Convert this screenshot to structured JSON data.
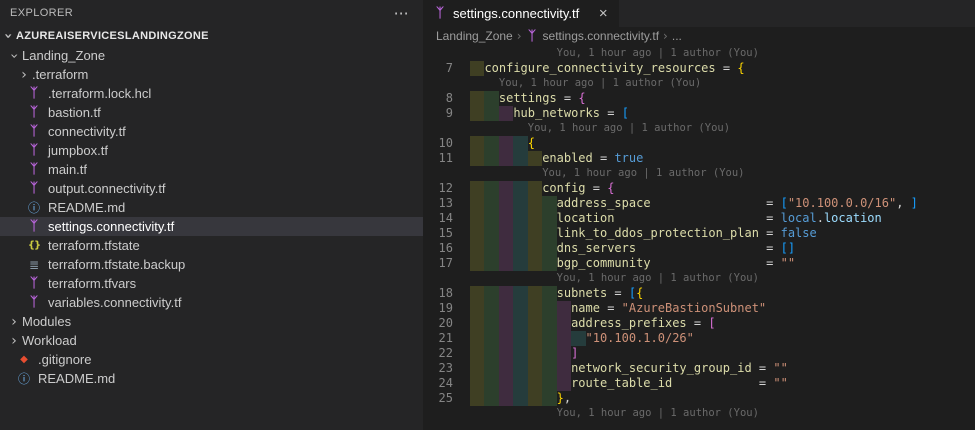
{
  "colors": {
    "accent": "#b764d8",
    "property": "#dcdcaa",
    "string": "#ce9178",
    "keyword": "#569cd6",
    "member": "#9cdcfe",
    "b1": "#ffd700",
    "b2": "#da70d6",
    "b3": "#179fff",
    "indent_colors": [
      "rgba(255,255,64,0.15)",
      "rgba(127,255,127,0.15)",
      "rgba(255,127,255,0.15)",
      "rgba(79,236,236,0.15)"
    ]
  },
  "icons": {
    "terraform": "ᛉ",
    "readme": "ⓘ",
    "json": "{}",
    "backup": "≣",
    "git": "◆",
    "more": "⋯",
    "chevron": "›",
    "close": "×"
  },
  "explorer": {
    "title": "EXPLORER",
    "workspace": "AZUREAISERVICESLANDINGZONE",
    "items": [
      {
        "label": "Landing_Zone",
        "type": "folder",
        "expanded": true,
        "depth": 0
      },
      {
        "label": ".terraform",
        "type": "folder",
        "expanded": false,
        "depth": 1
      },
      {
        "label": ".terraform.lock.hcl",
        "type": "terraform",
        "depth": 1
      },
      {
        "label": "bastion.tf",
        "type": "terraform",
        "depth": 1
      },
      {
        "label": "connectivity.tf",
        "type": "terraform",
        "depth": 1
      },
      {
        "label": "jumpbox.tf",
        "type": "terraform",
        "depth": 1
      },
      {
        "label": "main.tf",
        "type": "terraform",
        "depth": 1
      },
      {
        "label": "output.connectivity.tf",
        "type": "terraform",
        "depth": 1
      },
      {
        "label": "README.md",
        "type": "readme",
        "depth": 1
      },
      {
        "label": "settings.connectivity.tf",
        "type": "terraform",
        "depth": 1,
        "selected": true
      },
      {
        "label": "terraform.tfstate",
        "type": "json",
        "depth": 1
      },
      {
        "label": "terraform.tfstate.backup",
        "type": "backup",
        "depth": 1
      },
      {
        "label": "terraform.tfvars",
        "type": "terraform",
        "depth": 1
      },
      {
        "label": "variables.connectivity.tf",
        "type": "terraform",
        "depth": 1
      },
      {
        "label": "Modules",
        "type": "folder",
        "expanded": false,
        "depth": 0
      },
      {
        "label": "Workload",
        "type": "folder",
        "expanded": false,
        "depth": 0
      },
      {
        "label": ".gitignore",
        "type": "git",
        "depth": 0
      },
      {
        "label": "README.md",
        "type": "readme",
        "depth": 0
      }
    ]
  },
  "editor": {
    "tab": {
      "label": "settings.connectivity.tf"
    },
    "breadcrumbs": [
      "Landing_Zone",
      "settings.connectivity.tf",
      "..."
    ],
    "blame_text": "You, 1 hour ago | 1 author (You)",
    "lines": [
      {
        "type": "blame",
        "indent": 12
      },
      {
        "type": "code",
        "num": "7",
        "level": 1,
        "tokens": [
          [
            "p",
            "configure_connectivity_resources"
          ],
          [
            "o",
            " = "
          ],
          [
            "b1",
            "{"
          ]
        ]
      },
      {
        "type": "blame",
        "indent": 4
      },
      {
        "type": "code",
        "num": "8",
        "level": 2,
        "tokens": [
          [
            "p",
            "settings"
          ],
          [
            "o",
            " = "
          ],
          [
            "b2",
            "{"
          ]
        ]
      },
      {
        "type": "code",
        "num": "9",
        "level": 3,
        "tokens": [
          [
            "p",
            "hub_networks"
          ],
          [
            "o",
            " = "
          ],
          [
            "b3",
            "["
          ]
        ]
      },
      {
        "type": "blame",
        "indent": 8
      },
      {
        "type": "code",
        "num": "10",
        "level": 4,
        "tokens": [
          [
            "b1",
            "{"
          ]
        ]
      },
      {
        "type": "code",
        "num": "11",
        "level": 5,
        "tokens": [
          [
            "p",
            "enabled"
          ],
          [
            "o",
            " = "
          ],
          [
            "k",
            "true"
          ]
        ]
      },
      {
        "type": "blame",
        "indent": 10
      },
      {
        "type": "code",
        "num": "12",
        "level": 5,
        "tokens": [
          [
            "p",
            "config"
          ],
          [
            "o",
            " = "
          ],
          [
            "b2",
            "{"
          ]
        ]
      },
      {
        "type": "code",
        "num": "13",
        "level": 6,
        "tokens": [
          [
            "p",
            "address_space"
          ],
          [
            "o",
            "                = "
          ],
          [
            "b3",
            "["
          ],
          [
            "s",
            "\"10.100.0.0/16\""
          ],
          [
            "o",
            ", "
          ],
          [
            "b3",
            "]"
          ]
        ]
      },
      {
        "type": "code",
        "num": "14",
        "level": 6,
        "tokens": [
          [
            "p",
            "location"
          ],
          [
            "o",
            "                     = "
          ],
          [
            "k",
            "local"
          ],
          [
            "o",
            "."
          ],
          [
            "v",
            "location"
          ]
        ]
      },
      {
        "type": "code",
        "num": "15",
        "level": 6,
        "tokens": [
          [
            "p",
            "link_to_ddos_protection_plan"
          ],
          [
            "o",
            " = "
          ],
          [
            "k",
            "false"
          ]
        ]
      },
      {
        "type": "code",
        "num": "16",
        "level": 6,
        "tokens": [
          [
            "p",
            "dns_servers"
          ],
          [
            "o",
            "                  = "
          ],
          [
            "b3",
            "[]"
          ]
        ]
      },
      {
        "type": "code",
        "num": "17",
        "level": 6,
        "tokens": [
          [
            "p",
            "bgp_community"
          ],
          [
            "o",
            "                = "
          ],
          [
            "s",
            "\"\""
          ]
        ]
      },
      {
        "type": "blame",
        "indent": 12
      },
      {
        "type": "code",
        "num": "18",
        "level": 6,
        "tokens": [
          [
            "p",
            "subnets"
          ],
          [
            "o",
            " = "
          ],
          [
            "b3",
            "["
          ],
          [
            "b1",
            "{"
          ]
        ]
      },
      {
        "type": "code",
        "num": "19",
        "level": 7,
        "tokens": [
          [
            "p",
            "name"
          ],
          [
            "o",
            " = "
          ],
          [
            "s",
            "\"AzureBastionSubnet\""
          ]
        ]
      },
      {
        "type": "code",
        "num": "20",
        "level": 7,
        "tokens": [
          [
            "p",
            "address_prefixes"
          ],
          [
            "o",
            " = "
          ],
          [
            "b2",
            "["
          ]
        ]
      },
      {
        "type": "code",
        "num": "21",
        "level": 8,
        "tokens": [
          [
            "s",
            "\"10.100.1.0/26\""
          ]
        ]
      },
      {
        "type": "code",
        "num": "22",
        "level": 7,
        "tokens": [
          [
            "b2",
            "]"
          ]
        ]
      },
      {
        "type": "code",
        "num": "23",
        "level": 7,
        "tokens": [
          [
            "p",
            "network_security_group_id"
          ],
          [
            "o",
            " = "
          ],
          [
            "s",
            "\"\""
          ]
        ]
      },
      {
        "type": "code",
        "num": "24",
        "level": 7,
        "tokens": [
          [
            "p",
            "route_table_id"
          ],
          [
            "o",
            "            = "
          ],
          [
            "s",
            "\"\""
          ]
        ]
      },
      {
        "type": "code",
        "num": "25",
        "level": 6,
        "tokens": [
          [
            "b1",
            "}"
          ],
          [
            "o",
            ","
          ]
        ]
      },
      {
        "type": "blame",
        "indent": 12
      }
    ]
  }
}
